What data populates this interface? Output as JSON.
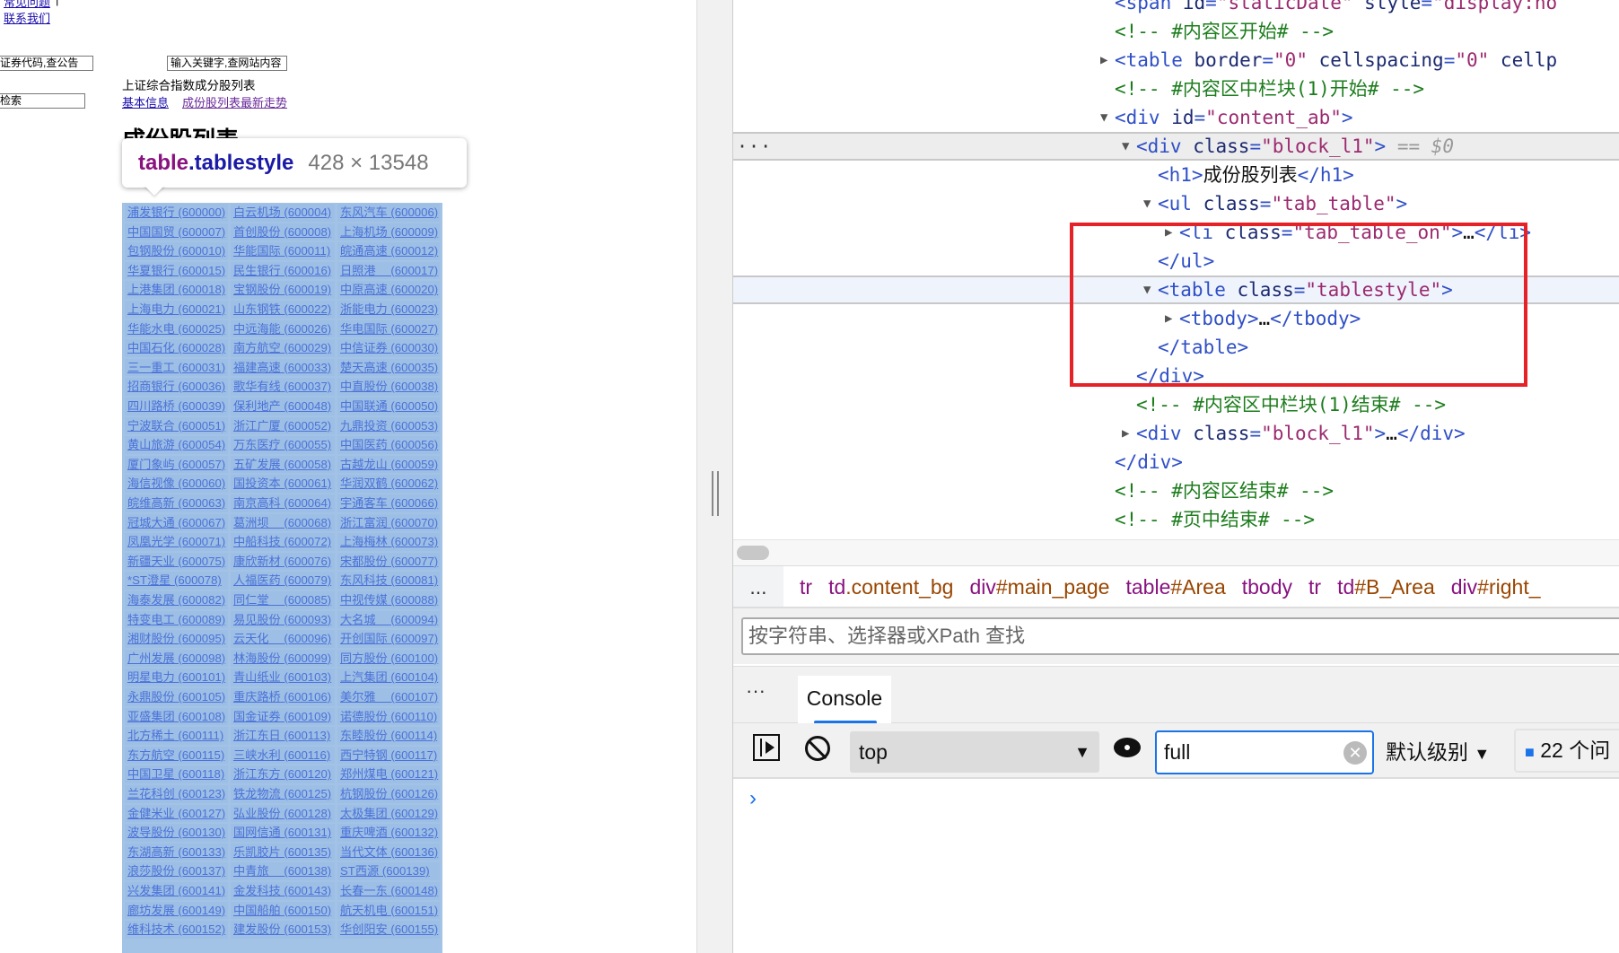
{
  "page": {
    "faq_link": "常见问题",
    "contact_link": "联系我们",
    "code_search_placeholder": "证券代码,查公告",
    "keyword_search_placeholder": "输入关键字,查网站内容",
    "retrieve_input": "检索",
    "list_title": "上证综合指数成分股列表",
    "tab_basic_info": "基本信息",
    "tab_component_trend": "成份股列表最新走势",
    "heading": "成份股列表",
    "table_rows": [
      [
        "浦发银行 (600000)",
        "白云机场 (600004)",
        "东风汽车 (600006)"
      ],
      [
        "中国国贸 (600007)",
        "首创股份 (600008)",
        "上海机场 (600009)"
      ],
      [
        "包钢股份 (600010)",
        "华能国际 (600011)",
        "皖通高速 (600012)"
      ],
      [
        "华夏银行 (600015)",
        "民生银行 (600016)",
        "日照港　 (600017)"
      ],
      [
        "上港集团 (600018)",
        "宝钢股份 (600019)",
        "中原高速 (600020)"
      ],
      [
        "上海电力 (600021)",
        "山东钢铁 (600022)",
        "浙能电力 (600023)"
      ],
      [
        "华能水电 (600025)",
        "中远海能 (600026)",
        "华电国际 (600027)"
      ],
      [
        "中国石化 (600028)",
        "南方航空 (600029)",
        "中信证券 (600030)"
      ],
      [
        "三一重工 (600031)",
        "福建高速 (600033)",
        "楚天高速 (600035)"
      ],
      [
        "招商银行 (600036)",
        "歌华有线 (600037)",
        "中直股份 (600038)"
      ],
      [
        "四川路桥 (600039)",
        "保利地产 (600048)",
        "中国联通 (600050)"
      ],
      [
        "宁波联合 (600051)",
        "浙江广厦 (600052)",
        "九鼎投资 (600053)"
      ],
      [
        "黄山旅游 (600054)",
        "万东医疗 (600055)",
        "中国医药 (600056)"
      ],
      [
        "厦门象屿 (600057)",
        "五矿发展 (600058)",
        "古越龙山 (600059)"
      ],
      [
        "海信视像 (600060)",
        "国投资本 (600061)",
        "华润双鹤 (600062)"
      ],
      [
        "皖维高新 (600063)",
        "南京高科 (600064)",
        "宇通客车 (600066)"
      ],
      [
        "冠城大通 (600067)",
        "葛洲坝　 (600068)",
        "浙江富润 (600070)"
      ],
      [
        "凤凰光学 (600071)",
        "中船科技 (600072)",
        "上海梅林 (600073)"
      ],
      [
        "新疆天业 (600075)",
        "康欣新材 (600076)",
        "宋都股份 (600077)"
      ],
      [
        "*ST澄星 (600078)",
        "人福医药 (600079)",
        "东风科技 (600081)"
      ],
      [
        "海泰发展 (600082)",
        "同仁堂　 (600085)",
        "中视传媒 (600088)"
      ],
      [
        "特变电工 (600089)",
        "易见股份 (600093)",
        "大名城　 (600094)"
      ],
      [
        "湘财股份 (600095)",
        "云天化　 (600096)",
        "开创国际 (600097)"
      ],
      [
        "广州发展 (600098)",
        "林海股份 (600099)",
        "同方股份 (600100)"
      ],
      [
        "明星电力 (600101)",
        "青山纸业 (600103)",
        "上汽集团 (600104)"
      ],
      [
        "永鼎股份 (600105)",
        "重庆路桥 (600106)",
        "美尔雅　 (600107)"
      ],
      [
        "亚盛集团 (600108)",
        "国金证券 (600109)",
        "诺德股份 (600110)"
      ],
      [
        "北方稀土 (600111)",
        "浙江东日 (600113)",
        "东睦股份 (600114)"
      ],
      [
        "东方航空 (600115)",
        "三峡水利 (600116)",
        "西宁特钢 (600117)"
      ],
      [
        "中国卫星 (600118)",
        "浙江东方 (600120)",
        "郑州煤电 (600121)"
      ],
      [
        "兰花科创 (600123)",
        "铁龙物流 (600125)",
        "杭钢股份 (600126)"
      ],
      [
        "金健米业 (600127)",
        "弘业股份 (600128)",
        "太极集团 (600129)"
      ],
      [
        "波导股份 (600130)",
        "国网信通 (600131)",
        "重庆啤酒 (600132)"
      ],
      [
        "东湖高新 (600133)",
        "乐凯胶片 (600135)",
        "当代文体 (600136)"
      ],
      [
        "浪莎股份 (600137)",
        "中青旅　 (600138)",
        "ST西源 (600139)"
      ],
      [
        "兴发集团 (600141)",
        "金发科技 (600143)",
        "长春一东 (600148)"
      ],
      [
        "廊坊发展 (600149)",
        "中国船舶 (600150)",
        "航天机电 (600151)"
      ],
      [
        "维科技术 (600152)",
        "建发股份 (600153)",
        "华创阳安 (600155)"
      ]
    ]
  },
  "inspect_tooltip": {
    "tag": "table",
    "class": ".tablestyle",
    "size": "428 × 13548"
  },
  "devtools": {
    "dom_lines": [
      {
        "indent": 0,
        "arrow": "",
        "parts": [
          [
            "tag",
            "<span "
          ],
          [
            "attr",
            "id"
          ],
          [
            "tag",
            "="
          ],
          [
            "val",
            "\"staticDate\""
          ],
          [
            "attr",
            " style"
          ],
          [
            "tag",
            "="
          ],
          [
            "val",
            "\"display:no"
          ]
        ]
      },
      {
        "indent": 0,
        "arrow": "",
        "parts": [
          [
            "com",
            "<!-- #内容区开始# -->"
          ]
        ]
      },
      {
        "indent": 0,
        "arrow": "right",
        "parts": [
          [
            "tag",
            "<table "
          ],
          [
            "attr",
            "border"
          ],
          [
            "tag",
            "="
          ],
          [
            "val",
            "\"0\""
          ],
          [
            "attr",
            " cellspacing"
          ],
          [
            "tag",
            "="
          ],
          [
            "val",
            "\"0\""
          ],
          [
            "attr",
            " cellp"
          ]
        ]
      },
      {
        "indent": 0,
        "arrow": "",
        "parts": [
          [
            "com",
            "<!-- #内容区中栏块(1)开始# -->"
          ]
        ]
      },
      {
        "indent": 0,
        "arrow": "down",
        "parts": [
          [
            "tag",
            "<div "
          ],
          [
            "attr",
            "id"
          ],
          [
            "tag",
            "="
          ],
          [
            "val",
            "\"content_ab\""
          ],
          [
            "tag",
            ">"
          ]
        ]
      },
      {
        "indent": 1,
        "arrow": "down",
        "state": "selected",
        "parts": [
          [
            "tag",
            "<div "
          ],
          [
            "attr",
            "class"
          ],
          [
            "tag",
            "="
          ],
          [
            "val",
            "\"block_l1\""
          ],
          [
            "tag",
            ">"
          ],
          [
            "ref",
            " == $0"
          ]
        ]
      },
      {
        "indent": 2,
        "arrow": "",
        "parts": [
          [
            "tag",
            "<h1>"
          ],
          [
            "text",
            "成份股列表"
          ],
          [
            "tag",
            "</h1>"
          ]
        ]
      },
      {
        "indent": 2,
        "arrow": "down",
        "parts": [
          [
            "tag",
            "<ul "
          ],
          [
            "attr",
            "class"
          ],
          [
            "tag",
            "="
          ],
          [
            "val",
            "\"tab_table\""
          ],
          [
            "tag",
            ">"
          ]
        ]
      },
      {
        "indent": 3,
        "arrow": "right",
        "parts": [
          [
            "tag",
            "<li "
          ],
          [
            "attr",
            "class"
          ],
          [
            "tag",
            "="
          ],
          [
            "val",
            "\"tab_table_on\""
          ],
          [
            "tag",
            ">"
          ],
          [
            "text",
            "…"
          ],
          [
            "tag",
            "</li>"
          ]
        ]
      },
      {
        "indent": 2,
        "arrow": "",
        "parts": [
          [
            "tag",
            "</ul>"
          ]
        ]
      },
      {
        "indent": 2,
        "arrow": "down",
        "state": "hovered",
        "parts": [
          [
            "tag",
            "<table "
          ],
          [
            "attr",
            "class"
          ],
          [
            "tag",
            "="
          ],
          [
            "val",
            "\"tablestyle\""
          ],
          [
            "tag",
            ">"
          ]
        ]
      },
      {
        "indent": 3,
        "arrow": "right",
        "parts": [
          [
            "tag",
            "<tbody>"
          ],
          [
            "text",
            "…"
          ],
          [
            "tag",
            "</tbody>"
          ]
        ]
      },
      {
        "indent": 2,
        "arrow": "",
        "parts": [
          [
            "tag",
            "</table>"
          ]
        ]
      },
      {
        "indent": 1,
        "arrow": "",
        "parts": [
          [
            "tag",
            "</div>"
          ]
        ]
      },
      {
        "indent": 1,
        "arrow": "",
        "parts": [
          [
            "com",
            "<!-- #内容区中栏块(1)结束# -->"
          ]
        ]
      },
      {
        "indent": 1,
        "arrow": "right",
        "parts": [
          [
            "tag",
            "<div "
          ],
          [
            "attr",
            "class"
          ],
          [
            "tag",
            "="
          ],
          [
            "val",
            "\"block_l1\""
          ],
          [
            "tag",
            ">"
          ],
          [
            "text",
            "…"
          ],
          [
            "tag",
            "</div>"
          ]
        ]
      },
      {
        "indent": 0,
        "arrow": "",
        "parts": [
          [
            "tag",
            "</div>"
          ]
        ]
      },
      {
        "indent": 0,
        "arrow": "",
        "parts": [
          [
            "com",
            "<!-- #内容区结束# -->"
          ]
        ]
      },
      {
        "indent": 0,
        "arrow": "",
        "parts": [
          [
            "com",
            "<!-- #页中结束# -->"
          ]
        ]
      }
    ],
    "breadcrumbs": [
      [
        "tr",
        ""
      ],
      [
        "td",
        ".content_bg"
      ],
      [
        "div",
        "#main_page"
      ],
      [
        "table",
        "#Area"
      ],
      [
        "tbody",
        ""
      ],
      [
        "tr",
        ""
      ],
      [
        "td",
        "#B_Area"
      ],
      [
        "div",
        "#right_"
      ]
    ],
    "breadcrumbs_more": "...",
    "find_placeholder": "按字符串、选择器或XPath 查找",
    "drawer_more": "···",
    "console_tab": "Console",
    "context_select": "top",
    "filter_value": "full",
    "log_level": "默认级别",
    "issues": "22 个问",
    "prompt": "›",
    "highlight_color": "#e52228",
    "accent_color": "#1a73e8"
  }
}
